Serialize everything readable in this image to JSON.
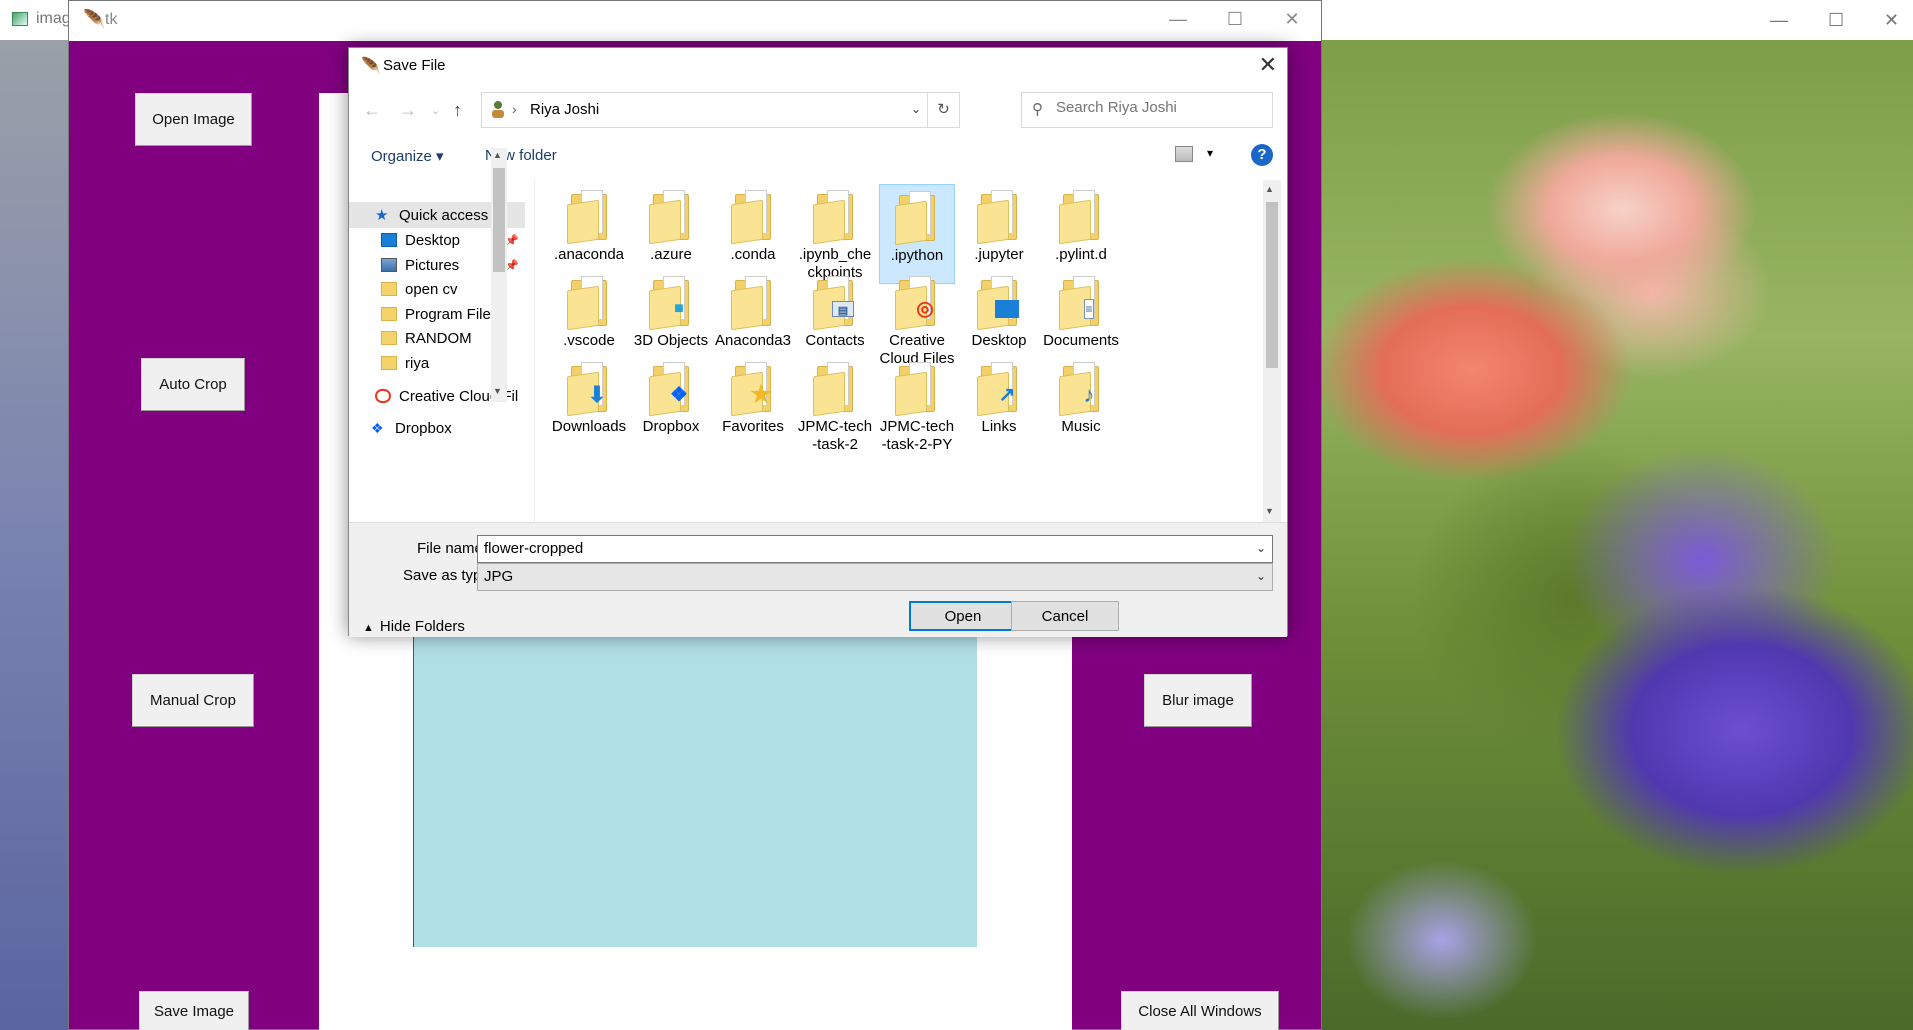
{
  "background_window": {
    "tab_title": "imag",
    "controls": [
      "—",
      "☐",
      "✕"
    ]
  },
  "tk_window": {
    "title": "tk",
    "controls": [
      "—",
      "☐",
      "✕"
    ],
    "buttons": {
      "open_image": "Open Image",
      "auto_crop": "Auto Crop",
      "manual_crop": "Manual Crop",
      "save_image": "Save Image",
      "blur_image": "Blur image",
      "close_all": "Close All Windows"
    },
    "colors": {
      "background": "#800080",
      "canvas": "#ffffff",
      "image_area": "#b0dfe5"
    }
  },
  "dialog": {
    "title": "Save File",
    "address": {
      "path": "Riya Joshi"
    },
    "search": {
      "placeholder": "Search Riya Joshi"
    },
    "toolbar": {
      "organize": "Organize ▾",
      "new_folder": "New folder",
      "help": "?"
    },
    "nav_items": [
      {
        "label": "Quick access",
        "icon": "star-icon",
        "selected": true
      },
      {
        "label": "Desktop",
        "icon": "desktop-icon",
        "pinned": true
      },
      {
        "label": "Pictures",
        "icon": "pictures-icon",
        "pinned": true
      },
      {
        "label": "open  cv",
        "icon": "folder-icon"
      },
      {
        "label": "Program Files",
        "icon": "folder-icon"
      },
      {
        "label": "RANDOM",
        "icon": "folder-icon"
      },
      {
        "label": "riya",
        "icon": "folder-icon"
      },
      {
        "label": "Creative Cloud Fil",
        "icon": "creative-cloud-icon"
      },
      {
        "label": "Dropbox",
        "icon": "dropbox-icon"
      }
    ],
    "files": [
      {
        "label": ".anaconda",
        "badge": ""
      },
      {
        "label": ".azure",
        "badge": ""
      },
      {
        "label": ".conda",
        "badge": ""
      },
      {
        "label": ".ipynb_checkpoints",
        "label_lines": [
          ".ipynb_che",
          "ckpoints"
        ],
        "badge": ""
      },
      {
        "label": ".ipython",
        "badge": "",
        "selected": true
      },
      {
        "label": ".jupyter",
        "badge": ""
      },
      {
        "label": ".pylint.d",
        "badge": ""
      },
      {
        "label": ".vscode",
        "badge": ""
      },
      {
        "label": "3D Objects",
        "badge": "cube"
      },
      {
        "label": "Anaconda3",
        "badge": ""
      },
      {
        "label": "Contacts",
        "badge": "contact"
      },
      {
        "label": "Creative Cloud Files",
        "label_lines": [
          "Creative",
          "Cloud Files"
        ],
        "badge": "cc"
      },
      {
        "label": "Desktop",
        "badge": "desktop"
      },
      {
        "label": "Documents",
        "badge": "docs"
      },
      {
        "label": "Downloads",
        "badge": "down"
      },
      {
        "label": "Dropbox",
        "badge": "dropbox"
      },
      {
        "label": "Favorites",
        "badge": "star"
      },
      {
        "label": "JPMC-tech-task-2",
        "label_lines": [
          "JPMC-tech",
          "-task-2"
        ],
        "badge": ""
      },
      {
        "label": "JPMC-tech-task-2-PY",
        "label_lines": [
          "JPMC-tech",
          "-task-2-PY"
        ],
        "badge": ""
      },
      {
        "label": "Links",
        "badge": "link"
      },
      {
        "label": "Music",
        "badge": "music"
      }
    ],
    "file_name_label": "File name:",
    "file_name_value": "flower-cropped",
    "save_type_label": "Save as type:",
    "save_type_value": "JPG",
    "hide_folders": "Hide Folders",
    "open_button": "Open",
    "cancel_button": "Cancel"
  }
}
